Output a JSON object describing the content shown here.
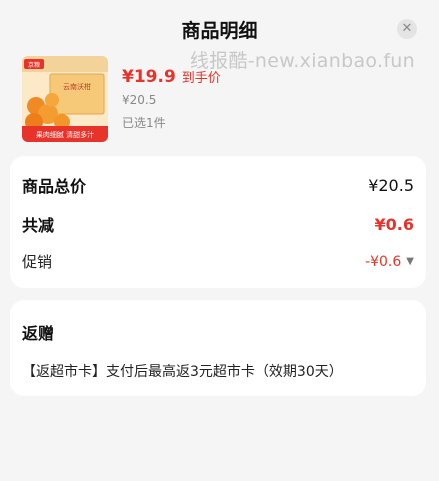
{
  "header": {
    "title": "商品明细",
    "close_icon": "close-icon",
    "watermark": "线报酷-new.xianbao.fun"
  },
  "product": {
    "image_icon": "product-thumbnail",
    "image_brand": "京粮",
    "image_name": "云南沃柑",
    "image_banner": "果肉细腻 清甜多汁",
    "price": "¥19.9",
    "price_tag": "到手价",
    "original_price": "¥20.5",
    "selected_count": "已选1件"
  },
  "summary": {
    "total_label": "商品总价",
    "total_value": "¥20.5",
    "discount_label": "共减",
    "discount_value": "¥0.6",
    "promo_label": "促销",
    "promo_value": "-¥0.6",
    "promo_icon": "chevron-down-icon"
  },
  "gift": {
    "title": "返赠",
    "description": "【返超市卡】支付后最高返3元超市卡（效期30天）"
  },
  "colors": {
    "accent_red": "#e8332a",
    "background": "#f5f5f5",
    "card": "#ffffff"
  }
}
